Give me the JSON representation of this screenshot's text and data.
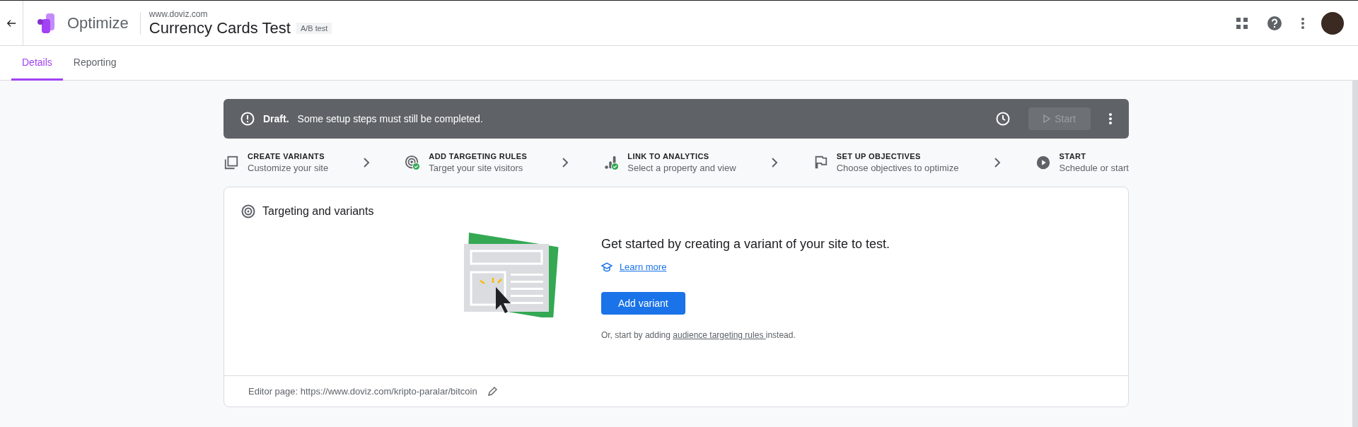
{
  "header": {
    "app_name": "Optimize",
    "site": "www.doviz.com",
    "title": "Currency Cards Test",
    "badge": "A/B test"
  },
  "tabs": [
    {
      "label": "Details",
      "selected": true
    },
    {
      "label": "Reporting",
      "selected": false
    }
  ],
  "banner": {
    "status": "Draft.",
    "message": "Some setup steps must still be completed.",
    "start_button": {
      "label": "Start",
      "disabled": true
    }
  },
  "steps": [
    {
      "kind": "variants",
      "title": "CREATE VARIANTS",
      "subtitle": "Customize your site",
      "completed": false
    },
    {
      "kind": "targeting",
      "title": "ADD TARGETING RULES",
      "subtitle": "Target your site visitors",
      "completed": true
    },
    {
      "kind": "analytics",
      "title": "LINK TO ANALYTICS",
      "subtitle": "Select a property and view",
      "completed": true
    },
    {
      "kind": "objectives",
      "title": "SET UP OBJECTIVES",
      "subtitle": "Choose objectives to optimize",
      "completed": false
    },
    {
      "kind": "start",
      "title": "START",
      "subtitle": "Schedule or start",
      "completed": false
    }
  ],
  "card": {
    "title": "Targeting and variants",
    "heading": "Get started by creating a variant of your site to test.",
    "learn_more": "Learn more",
    "button": "Add variant",
    "hint_before": "Or, start by adding",
    "hint_link": "audience targeting rules ",
    "hint_after": "instead.",
    "footer": "Editor page: https://www.doviz.com/kripto-paralar/bitcoin"
  }
}
